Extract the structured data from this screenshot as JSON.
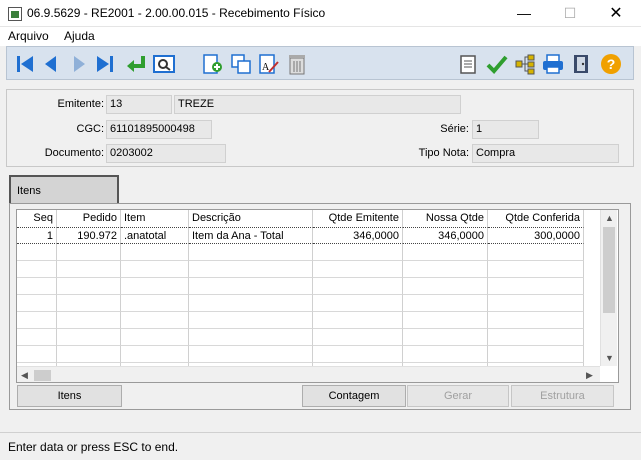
{
  "window": {
    "title": "06.9.5629 - RE2001 - 2.00.00.015 - Recebimento Físico",
    "minimize_glyph": "—",
    "maximize_glyph": "☐",
    "close_glyph": "✕"
  },
  "menu": {
    "items": [
      "Arquivo",
      "Ajuda"
    ]
  },
  "toolbar": {
    "icons": [
      "first-icon",
      "previous-icon",
      "next-icon",
      "last-icon",
      "return-icon",
      "search-icon",
      "new-icon",
      "copy-icon",
      "edit-icon",
      "delete-icon",
      "notes-icon",
      "check-icon",
      "tree-icon",
      "print-icon",
      "exit-icon",
      "help-icon"
    ],
    "colors": {
      "nav": "#1f6fd1",
      "check": "#2f9e2f",
      "help": "#f0a000"
    }
  },
  "header": {
    "emitente_label": "Emitente:",
    "emitente_code": "13",
    "emitente_name": "TREZE",
    "cgc_label": "CGC:",
    "cgc_value": "61101895000498",
    "serie_label": "Série:",
    "serie_value": "1",
    "documento_label": "Documento:",
    "documento_value": "0203002",
    "tipo_nota_label": "Tipo Nota:",
    "tipo_nota_value": "Compra"
  },
  "tabs": [
    {
      "label": "Itens"
    }
  ],
  "grid": {
    "columns": [
      "Seq",
      "Pedido",
      "Item",
      "Descrição",
      "Qtde Emitente",
      "Nossa Qtde",
      "Qtde Conferida"
    ],
    "rows": [
      [
        "1",
        "190.972",
        ".anatotal",
        "Item da Ana - Total",
        "346,0000",
        "346,0000",
        "300,0000"
      ]
    ]
  },
  "buttons": {
    "itens": "Itens",
    "contagem": "Contagem",
    "gerar": "Gerar",
    "estrutura": "Estrutura"
  },
  "status": {
    "text": "Enter data or press ESC to end."
  }
}
